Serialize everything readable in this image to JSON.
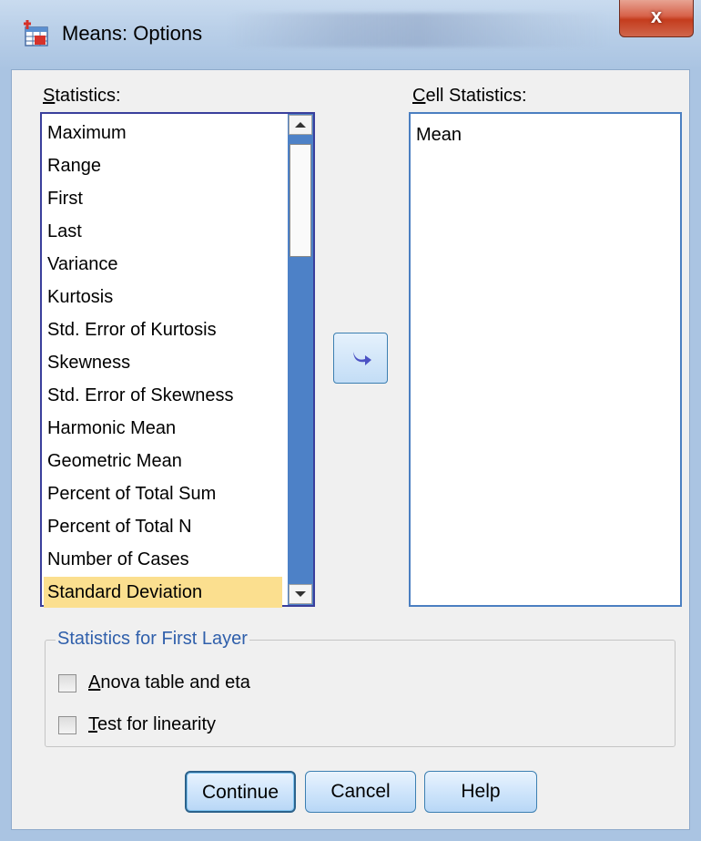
{
  "window": {
    "title": "Means: Options",
    "close_label": "x"
  },
  "statistics": {
    "label": "Statistics:",
    "items": [
      "Maximum",
      "Range",
      "First",
      "Last",
      "Variance",
      "Kurtosis",
      "Std. Error of Kurtosis",
      "Skewness",
      "Std. Error of Skewness",
      "Harmonic Mean",
      "Geometric Mean",
      "Percent of Total Sum",
      "Percent of Total N",
      "Number of Cases",
      "Standard Deviation"
    ],
    "selected": "Standard Deviation"
  },
  "cell_statistics": {
    "label": "Cell Statistics:",
    "items": [
      "Mean"
    ]
  },
  "first_layer": {
    "legend": "Statistics for First Layer",
    "anova_label": "Anova table and eta",
    "linearity_label": "Test for linearity",
    "anova_checked": false,
    "linearity_checked": false
  },
  "buttons": {
    "continue": "Continue",
    "cancel": "Cancel",
    "help": "Help"
  },
  "colors": {
    "selection": "#fbdf8f",
    "scrollbar": "#4d81c7",
    "legend_text": "#2f5fab"
  },
  "icons": {
    "app": "spss-table-icon",
    "move": "arrow-right-icon"
  }
}
